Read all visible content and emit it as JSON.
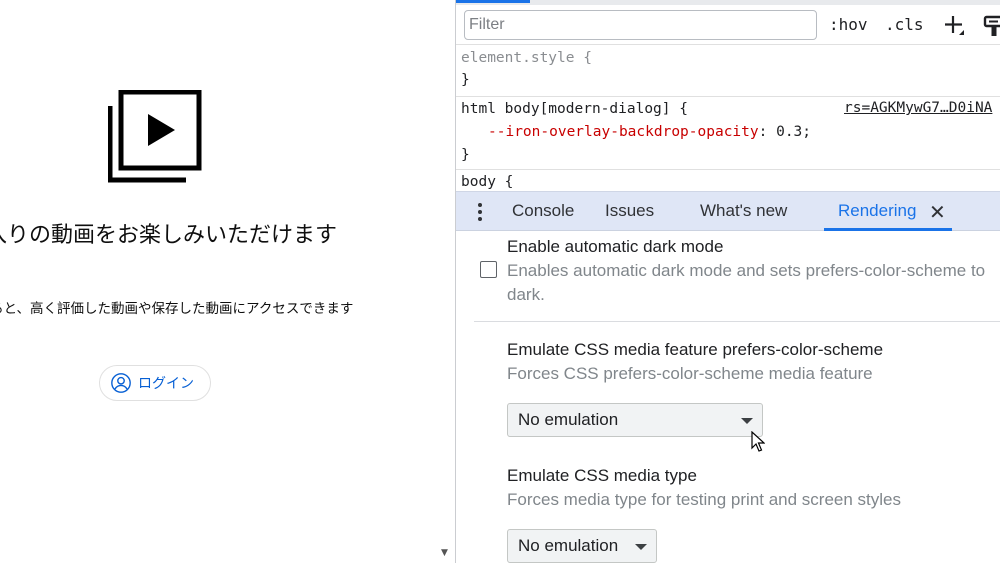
{
  "page": {
    "empty_title": "に入りの動画をお楽しみいただけます",
    "empty_subtitle": "すると、高く評価した動画や保存した動画にアクセスできます",
    "login_label": "ログイン",
    "playlist_icon": "playlist-play-icon",
    "account_icon": "account-circle-icon"
  },
  "styles_toolbar": {
    "filter_placeholder": "Filter",
    "hov_label": ":hov",
    "cls_label": ".cls",
    "new_rule_icon": "plus-icon",
    "computed_toggle_icon": "paint-roller-icon"
  },
  "css_rules": {
    "element_style_selector": "element.style {",
    "element_style_close": "}",
    "rule2_selector": "html body[modern-dialog] {",
    "rule2_prop": "--iron-overlay-backdrop-opacity",
    "rule2_value": ": 0.3;",
    "rule2_close": "}",
    "rule2_source": "rs=AGKMywG7…D0iNA",
    "rule3_selector": "body {"
  },
  "drawer": {
    "tabs": [
      {
        "label": "Console"
      },
      {
        "label": "Issues"
      },
      {
        "label": "What's new"
      },
      {
        "label": "Rendering"
      }
    ],
    "active_tab": "Rendering",
    "close_symbol": "✕"
  },
  "rendering": {
    "dark_mode_title": "Enable automatic dark mode",
    "dark_mode_desc": "Enables automatic dark mode and sets prefers-color-scheme to dark.",
    "dark_mode_checked": false,
    "color_scheme_title": "Emulate CSS media feature prefers-color-scheme",
    "color_scheme_desc": "Forces CSS prefers-color-scheme media feature",
    "color_scheme_value": "No emulation",
    "media_type_title": "Emulate CSS media type",
    "media_type_desc": "Forces media type for testing print and screen styles",
    "media_type_value": "No emulation"
  },
  "colors": {
    "accent": "#1a73e8",
    "drawer_bg": "#dfe6f6",
    "link_blue": "#065fd4",
    "css_property": "#c80000"
  }
}
